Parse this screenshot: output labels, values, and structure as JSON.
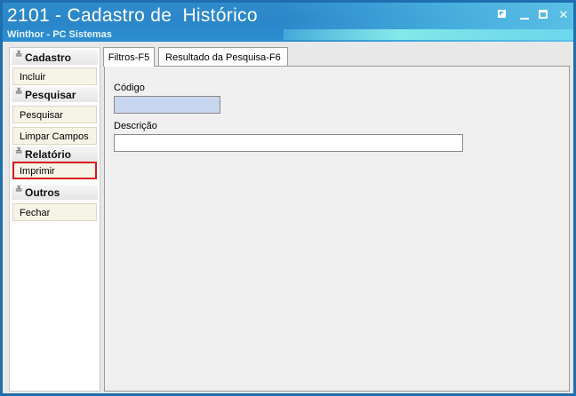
{
  "window": {
    "title": "2101 - Cadastro de  Histórico",
    "subtitle": "Winthor - PC Sistemas",
    "controls": [
      "restore-icon",
      "minimize-icon",
      "maximize-icon",
      "close-icon"
    ],
    "close_glyph": "✕"
  },
  "sidebar": {
    "groups": [
      {
        "label": "Cadastro",
        "items": [
          {
            "label": "Incluir"
          }
        ]
      },
      {
        "label": "Pesquisar",
        "items": [
          {
            "label": "Pesquisar"
          },
          {
            "label": "Limpar Campos"
          }
        ]
      },
      {
        "label": "Relatório",
        "items": [
          {
            "label": "Imprimir",
            "highlighted": true
          }
        ]
      },
      {
        "label": "Outros",
        "items": [
          {
            "label": "Fechar"
          }
        ]
      }
    ],
    "chevron_glyph": "≚"
  },
  "tabs": [
    {
      "label": "Filtros-F5",
      "active": true
    },
    {
      "label": "Resultado da Pesquisa-F6",
      "active": false
    }
  ],
  "filters": {
    "codigo": {
      "label": "Código",
      "value": ""
    },
    "descricao": {
      "label": "Descrição",
      "value": ""
    }
  },
  "colors": {
    "title_bar": "#2a86c8",
    "highlight_border": "#d8141f",
    "codigo_field": "#c9d6ef"
  }
}
